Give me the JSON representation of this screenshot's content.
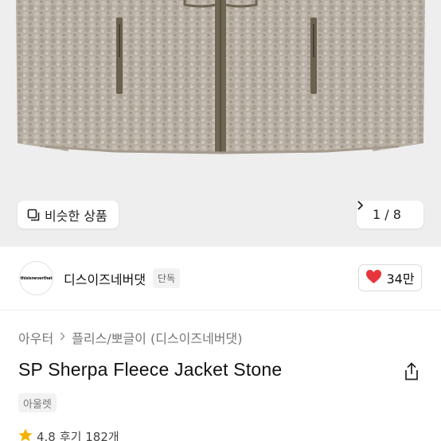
{
  "hero": {
    "similar_label": "비슷한 상품",
    "pager": "1 / 8"
  },
  "shop": {
    "logo_text": "thisisneverthat",
    "name": "디스이즈네버댓",
    "exclusive_badge": "단독",
    "likes": "34만"
  },
  "breadcrumb": {
    "level1": "아우터",
    "level2": "플리스/뽀글이 (디스이즈네버댓)"
  },
  "product": {
    "title": "SP Sherpa Fleece Jacket Stone",
    "badge": "아울렛",
    "rating": "4.8",
    "reviews": "후기 182개"
  },
  "colors": {
    "heart": "#e8343c",
    "star": "#f5b400",
    "hero_bg": "#eeeeef"
  }
}
